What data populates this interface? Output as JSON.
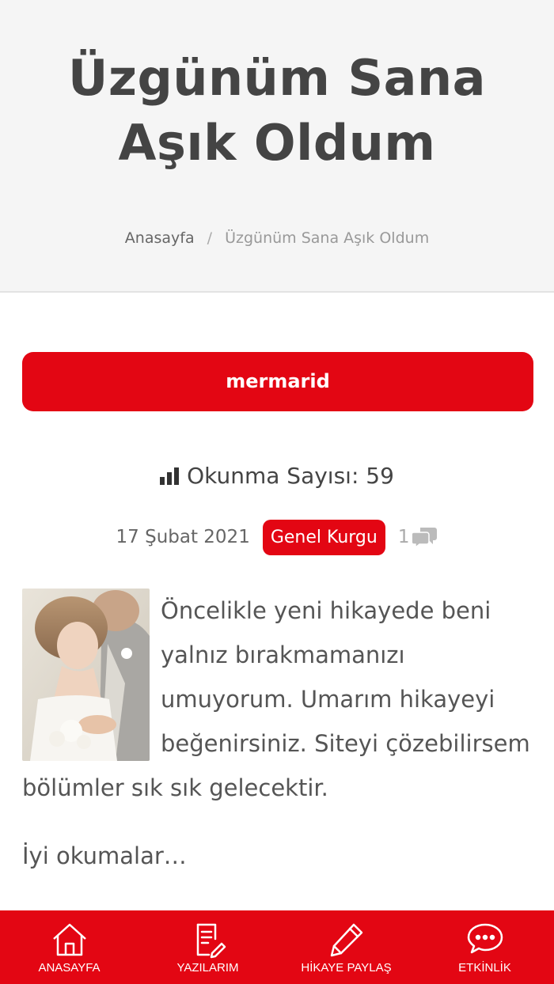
{
  "header": {
    "title": "Üzgünüm Sana Aşık Oldum",
    "breadcrumb": {
      "home": "Anasayfa",
      "separator": "/",
      "current": "Üzgünüm Sana Aşık Oldum"
    }
  },
  "story": {
    "author": "mermarid",
    "read_count_label": "Okunma Sayısı: 59",
    "date": "17 Şubat 2021",
    "category": "Genel Kurgu",
    "comment_count": "1",
    "paragraph_1": "Öncelikle yeni hikayede beni yalnız bırakmamanızı umuyorum. Umarım hikayeyi beğenirsiniz. Siteyi çözebilirsem bölümler sık sık gelecektir.",
    "paragraph_2": "İyi okumalar…"
  },
  "bottom_nav": {
    "items": [
      {
        "label": "ANASAYFA",
        "icon": "home-icon"
      },
      {
        "label": "YAZILARIM",
        "icon": "document-edit-icon"
      },
      {
        "label": "HİKAYE PAYLAŞ",
        "icon": "pencil-icon"
      },
      {
        "label": "ETKİNLİK",
        "icon": "chat-bubbles-icon"
      }
    ]
  },
  "colors": {
    "accent": "#e30613",
    "hero_bg": "#f5f5f5",
    "title_text": "#444444"
  }
}
